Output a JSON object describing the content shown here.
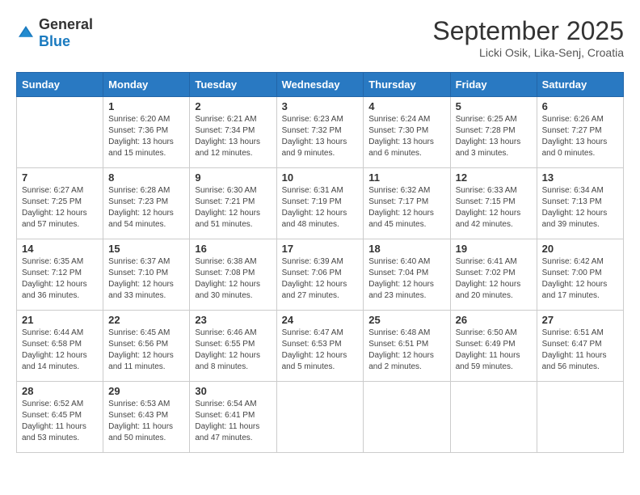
{
  "header": {
    "logo_general": "General",
    "logo_blue": "Blue",
    "month": "September 2025",
    "location": "Licki Osik, Lika-Senj, Croatia"
  },
  "weekdays": [
    "Sunday",
    "Monday",
    "Tuesday",
    "Wednesday",
    "Thursday",
    "Friday",
    "Saturday"
  ],
  "weeks": [
    [
      {
        "day": "",
        "empty": true
      },
      {
        "day": "1",
        "sunrise": "Sunrise: 6:20 AM",
        "sunset": "Sunset: 7:36 PM",
        "daylight": "Daylight: 13 hours and 15 minutes."
      },
      {
        "day": "2",
        "sunrise": "Sunrise: 6:21 AM",
        "sunset": "Sunset: 7:34 PM",
        "daylight": "Daylight: 13 hours and 12 minutes."
      },
      {
        "day": "3",
        "sunrise": "Sunrise: 6:23 AM",
        "sunset": "Sunset: 7:32 PM",
        "daylight": "Daylight: 13 hours and 9 minutes."
      },
      {
        "day": "4",
        "sunrise": "Sunrise: 6:24 AM",
        "sunset": "Sunset: 7:30 PM",
        "daylight": "Daylight: 13 hours and 6 minutes."
      },
      {
        "day": "5",
        "sunrise": "Sunrise: 6:25 AM",
        "sunset": "Sunset: 7:28 PM",
        "daylight": "Daylight: 13 hours and 3 minutes."
      },
      {
        "day": "6",
        "sunrise": "Sunrise: 6:26 AM",
        "sunset": "Sunset: 7:27 PM",
        "daylight": "Daylight: 13 hours and 0 minutes."
      }
    ],
    [
      {
        "day": "7",
        "sunrise": "Sunrise: 6:27 AM",
        "sunset": "Sunset: 7:25 PM",
        "daylight": "Daylight: 12 hours and 57 minutes."
      },
      {
        "day": "8",
        "sunrise": "Sunrise: 6:28 AM",
        "sunset": "Sunset: 7:23 PM",
        "daylight": "Daylight: 12 hours and 54 minutes."
      },
      {
        "day": "9",
        "sunrise": "Sunrise: 6:30 AM",
        "sunset": "Sunset: 7:21 PM",
        "daylight": "Daylight: 12 hours and 51 minutes."
      },
      {
        "day": "10",
        "sunrise": "Sunrise: 6:31 AM",
        "sunset": "Sunset: 7:19 PM",
        "daylight": "Daylight: 12 hours and 48 minutes."
      },
      {
        "day": "11",
        "sunrise": "Sunrise: 6:32 AM",
        "sunset": "Sunset: 7:17 PM",
        "daylight": "Daylight: 12 hours and 45 minutes."
      },
      {
        "day": "12",
        "sunrise": "Sunrise: 6:33 AM",
        "sunset": "Sunset: 7:15 PM",
        "daylight": "Daylight: 12 hours and 42 minutes."
      },
      {
        "day": "13",
        "sunrise": "Sunrise: 6:34 AM",
        "sunset": "Sunset: 7:13 PM",
        "daylight": "Daylight: 12 hours and 39 minutes."
      }
    ],
    [
      {
        "day": "14",
        "sunrise": "Sunrise: 6:35 AM",
        "sunset": "Sunset: 7:12 PM",
        "daylight": "Daylight: 12 hours and 36 minutes."
      },
      {
        "day": "15",
        "sunrise": "Sunrise: 6:37 AM",
        "sunset": "Sunset: 7:10 PM",
        "daylight": "Daylight: 12 hours and 33 minutes."
      },
      {
        "day": "16",
        "sunrise": "Sunrise: 6:38 AM",
        "sunset": "Sunset: 7:08 PM",
        "daylight": "Daylight: 12 hours and 30 minutes."
      },
      {
        "day": "17",
        "sunrise": "Sunrise: 6:39 AM",
        "sunset": "Sunset: 7:06 PM",
        "daylight": "Daylight: 12 hours and 27 minutes."
      },
      {
        "day": "18",
        "sunrise": "Sunrise: 6:40 AM",
        "sunset": "Sunset: 7:04 PM",
        "daylight": "Daylight: 12 hours and 23 minutes."
      },
      {
        "day": "19",
        "sunrise": "Sunrise: 6:41 AM",
        "sunset": "Sunset: 7:02 PM",
        "daylight": "Daylight: 12 hours and 20 minutes."
      },
      {
        "day": "20",
        "sunrise": "Sunrise: 6:42 AM",
        "sunset": "Sunset: 7:00 PM",
        "daylight": "Daylight: 12 hours and 17 minutes."
      }
    ],
    [
      {
        "day": "21",
        "sunrise": "Sunrise: 6:44 AM",
        "sunset": "Sunset: 6:58 PM",
        "daylight": "Daylight: 12 hours and 14 minutes."
      },
      {
        "day": "22",
        "sunrise": "Sunrise: 6:45 AM",
        "sunset": "Sunset: 6:56 PM",
        "daylight": "Daylight: 12 hours and 11 minutes."
      },
      {
        "day": "23",
        "sunrise": "Sunrise: 6:46 AM",
        "sunset": "Sunset: 6:55 PM",
        "daylight": "Daylight: 12 hours and 8 minutes."
      },
      {
        "day": "24",
        "sunrise": "Sunrise: 6:47 AM",
        "sunset": "Sunset: 6:53 PM",
        "daylight": "Daylight: 12 hours and 5 minutes."
      },
      {
        "day": "25",
        "sunrise": "Sunrise: 6:48 AM",
        "sunset": "Sunset: 6:51 PM",
        "daylight": "Daylight: 12 hours and 2 minutes."
      },
      {
        "day": "26",
        "sunrise": "Sunrise: 6:50 AM",
        "sunset": "Sunset: 6:49 PM",
        "daylight": "Daylight: 11 hours and 59 minutes."
      },
      {
        "day": "27",
        "sunrise": "Sunrise: 6:51 AM",
        "sunset": "Sunset: 6:47 PM",
        "daylight": "Daylight: 11 hours and 56 minutes."
      }
    ],
    [
      {
        "day": "28",
        "sunrise": "Sunrise: 6:52 AM",
        "sunset": "Sunset: 6:45 PM",
        "daylight": "Daylight: 11 hours and 53 minutes."
      },
      {
        "day": "29",
        "sunrise": "Sunrise: 6:53 AM",
        "sunset": "Sunset: 6:43 PM",
        "daylight": "Daylight: 11 hours and 50 minutes."
      },
      {
        "day": "30",
        "sunrise": "Sunrise: 6:54 AM",
        "sunset": "Sunset: 6:41 PM",
        "daylight": "Daylight: 11 hours and 47 minutes."
      },
      {
        "day": "",
        "empty": true
      },
      {
        "day": "",
        "empty": true
      },
      {
        "day": "",
        "empty": true
      },
      {
        "day": "",
        "empty": true
      }
    ]
  ]
}
